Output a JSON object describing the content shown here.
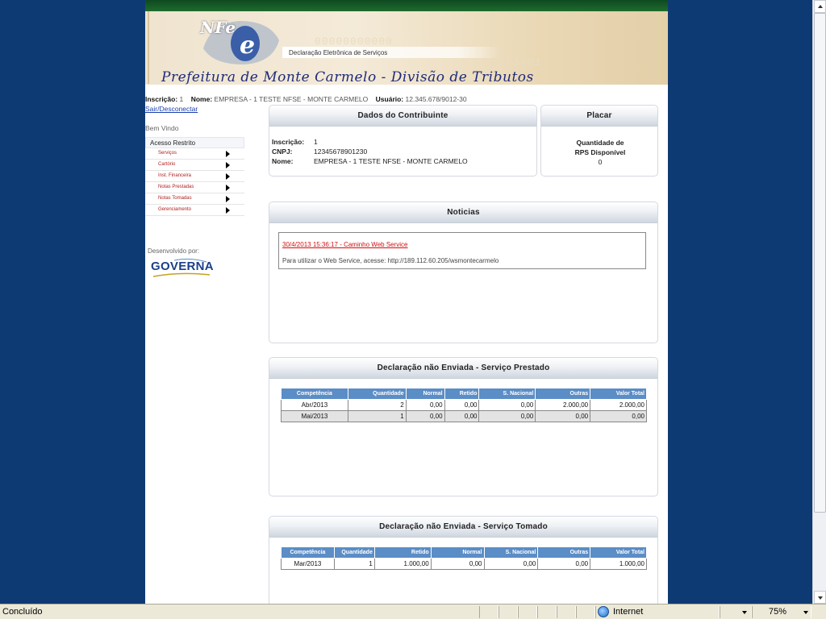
{
  "header": {
    "logo_text": "NFe",
    "subtitle": "Declaração Eletrônica de Serviços",
    "title": "Prefeitura de Monte Carmelo - Divisão de Tributos",
    "bg_digits_1": "00000000000",
    "bg_digits_2": "0101001"
  },
  "info": {
    "inscricao_label": "Inscrição:",
    "inscricao_value": "1",
    "nome_label": "Nome:",
    "nome_value": "EMPRESA - 1 TESTE NFSE - MONTE CARMELO",
    "usuario_label": "Usuário:",
    "usuario_value": "12.345.678/9012-30",
    "logout": "Sair/Desconectar"
  },
  "sidebar": {
    "welcome": "Bem Vindo",
    "menu_header": "Acesso Restrito",
    "items": [
      "Serviços",
      "Cartório",
      "Inst. Financeira",
      "Notas Prestadas",
      "Notas Tomadas",
      "Gerenciamento"
    ],
    "developed_by": "Desenvolvido por:",
    "brand": "GOVERNA"
  },
  "contribuinte": {
    "title": "Dados do Contribuinte",
    "inscricao_label": "Inscrição:",
    "inscricao_value": "1",
    "cnpj_label": "CNPJ:",
    "cnpj_value": "12345678901230",
    "nome_label": "Nome:",
    "nome_value": "EMPRESA - 1 TESTE NFSE - MONTE CARMELO"
  },
  "placar": {
    "title": "Placar",
    "label_1": "Quantidade de",
    "label_2": "RPS Disponível",
    "value": "0"
  },
  "noticias": {
    "title": "Noticias",
    "link": "30/4/2013 15:36:17 - Caminho Web Service",
    "text": "Para utilizar o Web Service, acesse: http://189.112.60.205/wsmontecarmelo"
  },
  "prestado": {
    "title": "Declaração não Enviada - Serviço Prestado",
    "columns": [
      "Competência",
      "Quantidade",
      "Normal",
      "Retido",
      "S. Nacional",
      "Outras",
      "Valor Total"
    ],
    "rows": [
      [
        "Abr/2013",
        "2",
        "0,00",
        "0,00",
        "0,00",
        "2.000,00",
        "2.000,00"
      ],
      [
        "Mai/2013",
        "1",
        "0,00",
        "0,00",
        "0,00",
        "0,00",
        "0,00"
      ]
    ]
  },
  "tomado": {
    "title": "Declaração não Enviada - Serviço Tomado",
    "columns": [
      "Competência",
      "Quantidade",
      "Retido",
      "Normal",
      "S. Nacional",
      "Outras",
      "Valor Total"
    ],
    "rows": [
      [
        "Mar/2013",
        "1",
        "1.000,00",
        "0,00",
        "0,00",
        "0,00",
        "1.000,00"
      ]
    ]
  },
  "status": {
    "text": "Concluído",
    "zone": "Internet",
    "zoom": "75%"
  },
  "colors": {
    "background": "#0e3a73",
    "table_header": "#5b8dc6",
    "link_red": "#d01010",
    "title_blue": "#1e2a7a"
  },
  "icons": [
    "globe-icon",
    "arrow-right-icon",
    "dropdown-icon",
    "scroll-up-icon",
    "scroll-down-icon"
  ]
}
